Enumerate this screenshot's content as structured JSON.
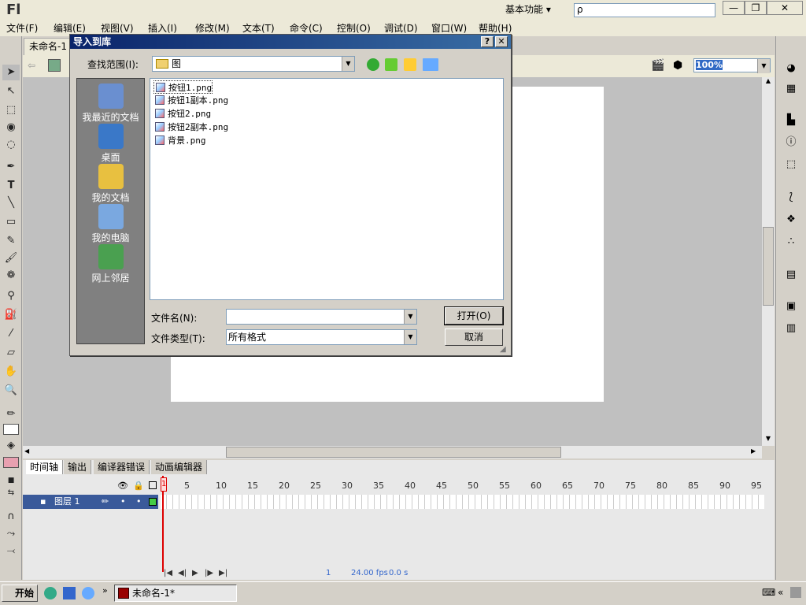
{
  "app": {
    "logo": "Fl",
    "workspace": "基本功能 ▾",
    "search_placeholder": "ρ"
  },
  "window_buttons": [
    "—",
    "❐",
    "✕"
  ],
  "menu": [
    "文件(F)",
    "编辑(E)",
    "视图(V)",
    "插入(I)",
    "修改(M)",
    "文本(T)",
    "命令(C)",
    "控制(O)",
    "调试(D)",
    "窗口(W)",
    "帮助(H)"
  ],
  "doc_tab": "未命名-1",
  "zoom": "100%",
  "dialog": {
    "title": "导入到库",
    "help_btn": "?",
    "close_btn": "✕",
    "lookin_label": "查找范围(I):",
    "lookin_value": "图",
    "places": [
      {
        "label": "我最近的文档",
        "color": "#6a8fd0"
      },
      {
        "label": "桌面",
        "color": "#3a78c8"
      },
      {
        "label": "我的文档",
        "color": "#e8c040"
      },
      {
        "label": "我的电脑",
        "color": "#7aa8e0"
      },
      {
        "label": "网上邻居",
        "color": "#4aa050"
      }
    ],
    "files": [
      "按钮1.png",
      "按钮1副本.png",
      "按钮2.png",
      "按钮2副本.png",
      "背景.png"
    ],
    "filename_label": "文件名(N):",
    "filename_value": "",
    "filetype_label": "文件类型(T):",
    "filetype_value": "所有格式",
    "open_btn": "打开(O)",
    "cancel_btn": "取消"
  },
  "timeline": {
    "tabs": [
      "时间轴",
      "输出",
      "编译器错误",
      "动画编辑器"
    ],
    "layer_name": "图层 1",
    "frame_numbers": [
      "5",
      "10",
      "15",
      "20",
      "25",
      "30",
      "35",
      "40",
      "45",
      "50",
      "55",
      "60",
      "65",
      "70",
      "75",
      "80",
      "85",
      "90",
      "95"
    ],
    "playhead_frame": "1",
    "current_frame": "1",
    "fps": "24.00 fps",
    "time": "0.0 s"
  },
  "taskbar": {
    "start": "开始",
    "item": "未命名-1*"
  }
}
